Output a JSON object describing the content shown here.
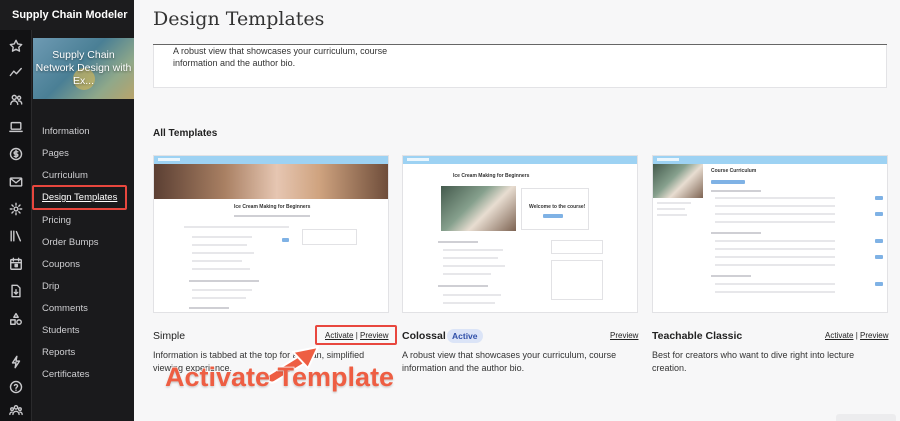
{
  "app": {
    "title": "Supply Chain Modeler"
  },
  "rail": {
    "icons": [
      "star-icon",
      "trend-icon",
      "users-icon",
      "laptop-icon",
      "dollar-icon",
      "mail-icon",
      "gear-icon",
      "library-icon",
      "calendar-icon",
      "download-doc-icon",
      "shapes-icon",
      "bolt-icon",
      "help-icon",
      "team-icon"
    ]
  },
  "course": {
    "card_title": "Supply Chain Network Design with Ex...",
    "nav": [
      "Information",
      "Pages",
      "Curriculum",
      "Design Templates",
      "Pricing",
      "Order Bumps",
      "Coupons",
      "Drip",
      "Comments",
      "Students",
      "Reports",
      "Certificates"
    ],
    "active_nav": "Design Templates"
  },
  "page": {
    "title": "Design Templates",
    "current_template_desc": "A robust view that showcases your curriculum, course information and the author bio.",
    "section_heading": "All Templates"
  },
  "templates": [
    {
      "name": "Simple",
      "activate_label": "Activate",
      "separator": "|",
      "preview_label": "Preview",
      "description": "Information is tabbed at the top for a clean, simplified viewing experience.",
      "thumb_title": "Ice Cream Making for Beginners"
    },
    {
      "name": "Colossal",
      "badge": "Active",
      "preview_label": "Preview",
      "description": "A robust view that showcases your curriculum, course information and the author bio.",
      "thumb_title": "Ice Cream Making for Beginners",
      "thumb_subtitle": "Welcome to the course!"
    },
    {
      "name": "Teachable Classic",
      "activate_label": "Activate",
      "separator": "|",
      "preview_label": "Preview",
      "description": "Best for creators who want to dive right into lecture creation.",
      "thumb_title": "Course Curriculum"
    }
  ],
  "annotation": {
    "text": "Activate Template",
    "color": "#ee5e43"
  },
  "colors": {
    "highlight": "#e8473e",
    "badge_bg": "#dbe4f7",
    "badge_text": "#2f4fa8",
    "thumb_bar": "#9dd2f3"
  }
}
